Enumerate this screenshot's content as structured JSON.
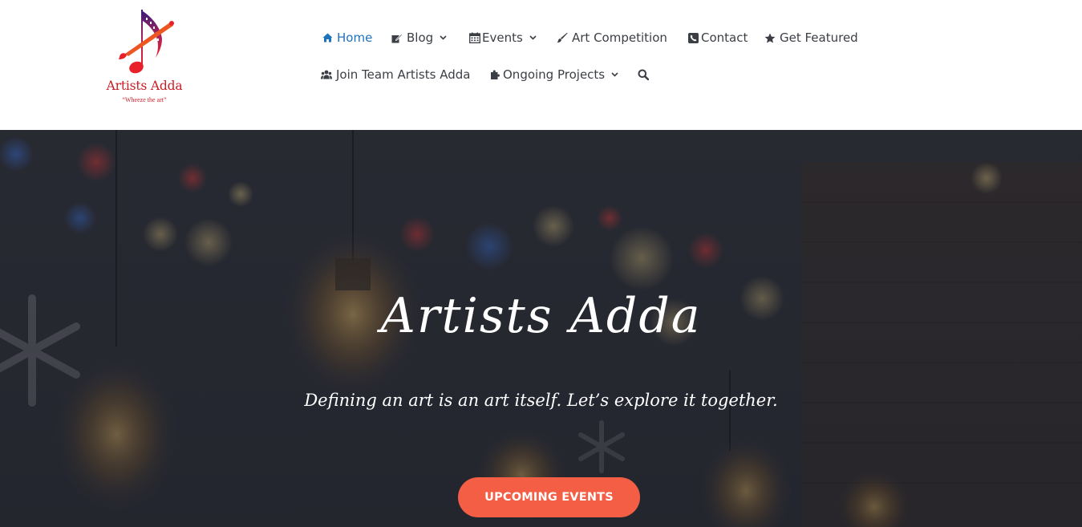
{
  "logo": {
    "name": "Artists Adda",
    "tagline": "“Wheeze the art”",
    "icon": "music-note-brush-logo"
  },
  "nav": {
    "items": [
      {
        "label": "Home",
        "icon": "home-icon",
        "active": true,
        "dropdown": false
      },
      {
        "label": "Blog",
        "icon": "edit-icon",
        "active": false,
        "dropdown": true
      },
      {
        "label": "Events",
        "icon": "calendar-icon",
        "active": false,
        "dropdown": true
      },
      {
        "label": "Art Competition",
        "icon": "paintbrush-icon",
        "active": false,
        "dropdown": false
      },
      {
        "label": "Contact",
        "icon": "phone-icon",
        "active": false,
        "dropdown": false
      },
      {
        "label": "Get Featured",
        "icon": "star-icon",
        "active": false,
        "dropdown": false
      },
      {
        "label": "Join Team Artists Adda",
        "icon": "users-icon",
        "active": false,
        "dropdown": false
      },
      {
        "label": "Ongoing Projects",
        "icon": "puzzle-icon",
        "active": false,
        "dropdown": true
      }
    ],
    "search_icon": "search-icon"
  },
  "hero": {
    "title": "Artists Adda",
    "subtitle": "Defining an art is an art itself. Let’s explore it together.",
    "cta_label": "UPCOMING EVENTS"
  },
  "colors": {
    "accent": "#1e73be",
    "nav_text": "#3b3f45",
    "cta": "#f35e45",
    "brand": "#c81d25",
    "hero_overlay": "#2b2d38"
  }
}
